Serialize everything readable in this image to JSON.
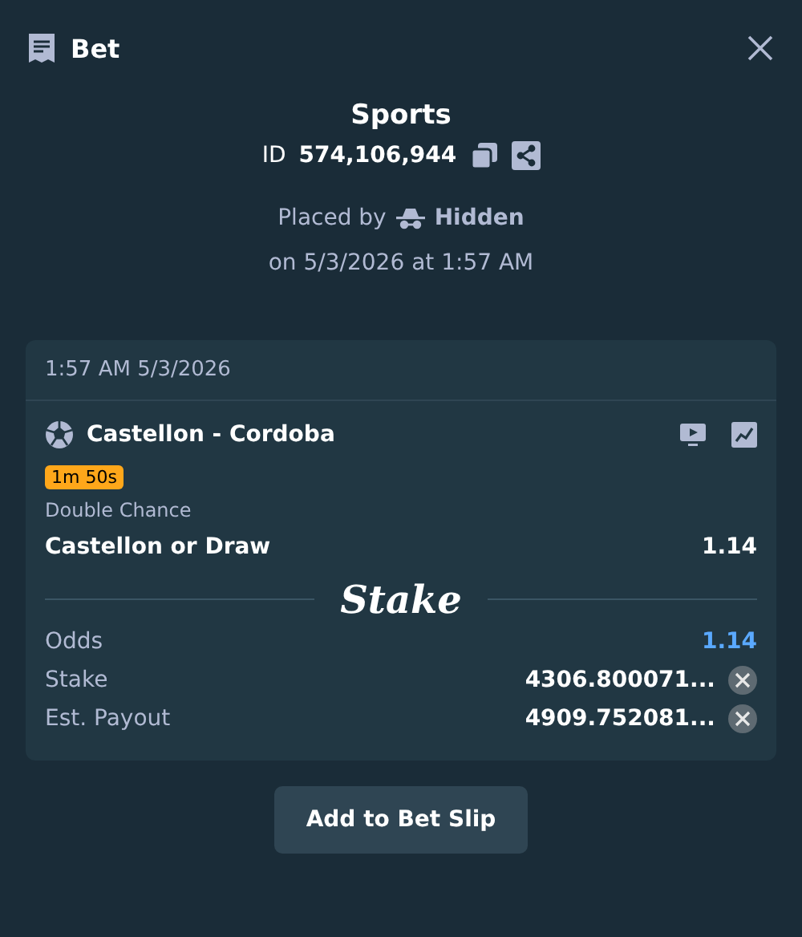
{
  "header": {
    "title": "Bet"
  },
  "summary": {
    "category": "Sports",
    "id_label": "ID",
    "id_value": "574,106,944",
    "placed_by_label": "Placed by",
    "placed_by_user": "Hidden",
    "placed_on": "on 5/3/2026 at 1:57 AM"
  },
  "card": {
    "timestamp": "1:57 AM 5/3/2026",
    "event": "Castellon - Cordoba",
    "timer": "1m 50s",
    "market": "Double Chance",
    "selection": "Castellon or Draw",
    "selection_odds": "1.14",
    "brand": "Stake",
    "rows": [
      {
        "kind": "odds",
        "label": "Odds",
        "value": "1.14"
      },
      {
        "kind": "amount",
        "label": "Stake",
        "value": "4306.800071..."
      },
      {
        "kind": "amount",
        "label": "Est. Payout",
        "value": "4909.752081..."
      }
    ]
  },
  "button": "Add to Bet Slip"
}
